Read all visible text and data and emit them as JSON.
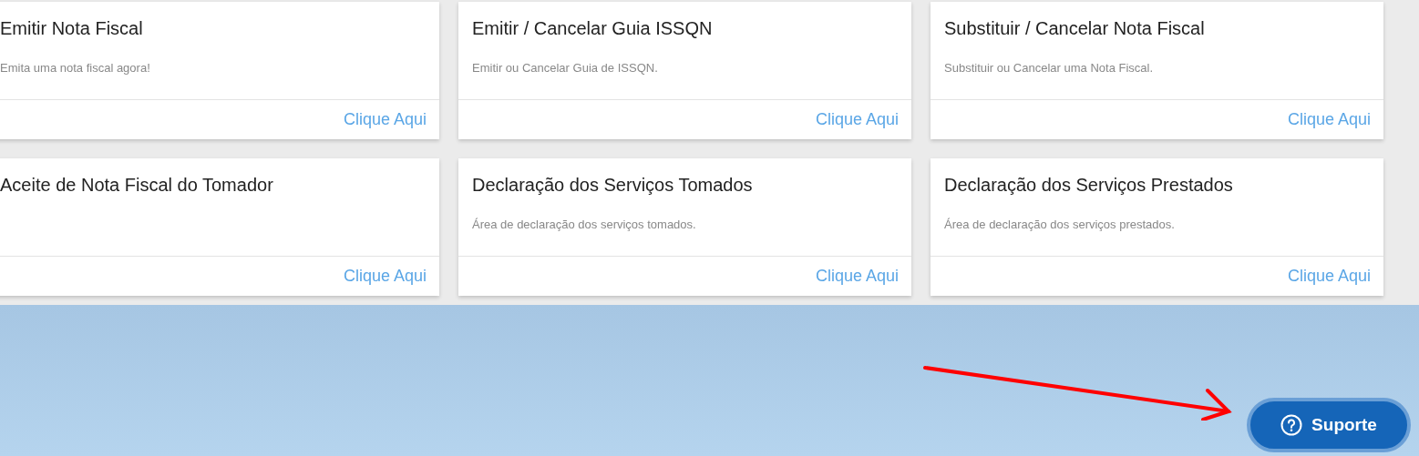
{
  "cards": [
    {
      "title": "Emitir Nota Fiscal",
      "description": "Emita uma nota fiscal agora!",
      "link": "Clique Aqui"
    },
    {
      "title": "Emitir / Cancelar Guia ISSQN",
      "description": "Emitir ou Cancelar Guia de ISSQN.",
      "link": "Clique Aqui"
    },
    {
      "title": "Substituir / Cancelar Nota Fiscal",
      "description": "Substituir ou Cancelar uma Nota Fiscal.",
      "link": "Clique Aqui"
    },
    {
      "title": "Aceite de Nota Fiscal do Tomador",
      "link": "Clique Aqui"
    },
    {
      "title": "Declaração dos Serviços Tomados",
      "description": "Área de declaração dos serviços tomados.",
      "link": "Clique Aqui"
    },
    {
      "title": "Declaração dos Serviços Prestados",
      "description": "Área de declaração dos serviços prestados.",
      "link": "Clique Aqui"
    }
  ],
  "support_button": {
    "label": "Suporte"
  }
}
